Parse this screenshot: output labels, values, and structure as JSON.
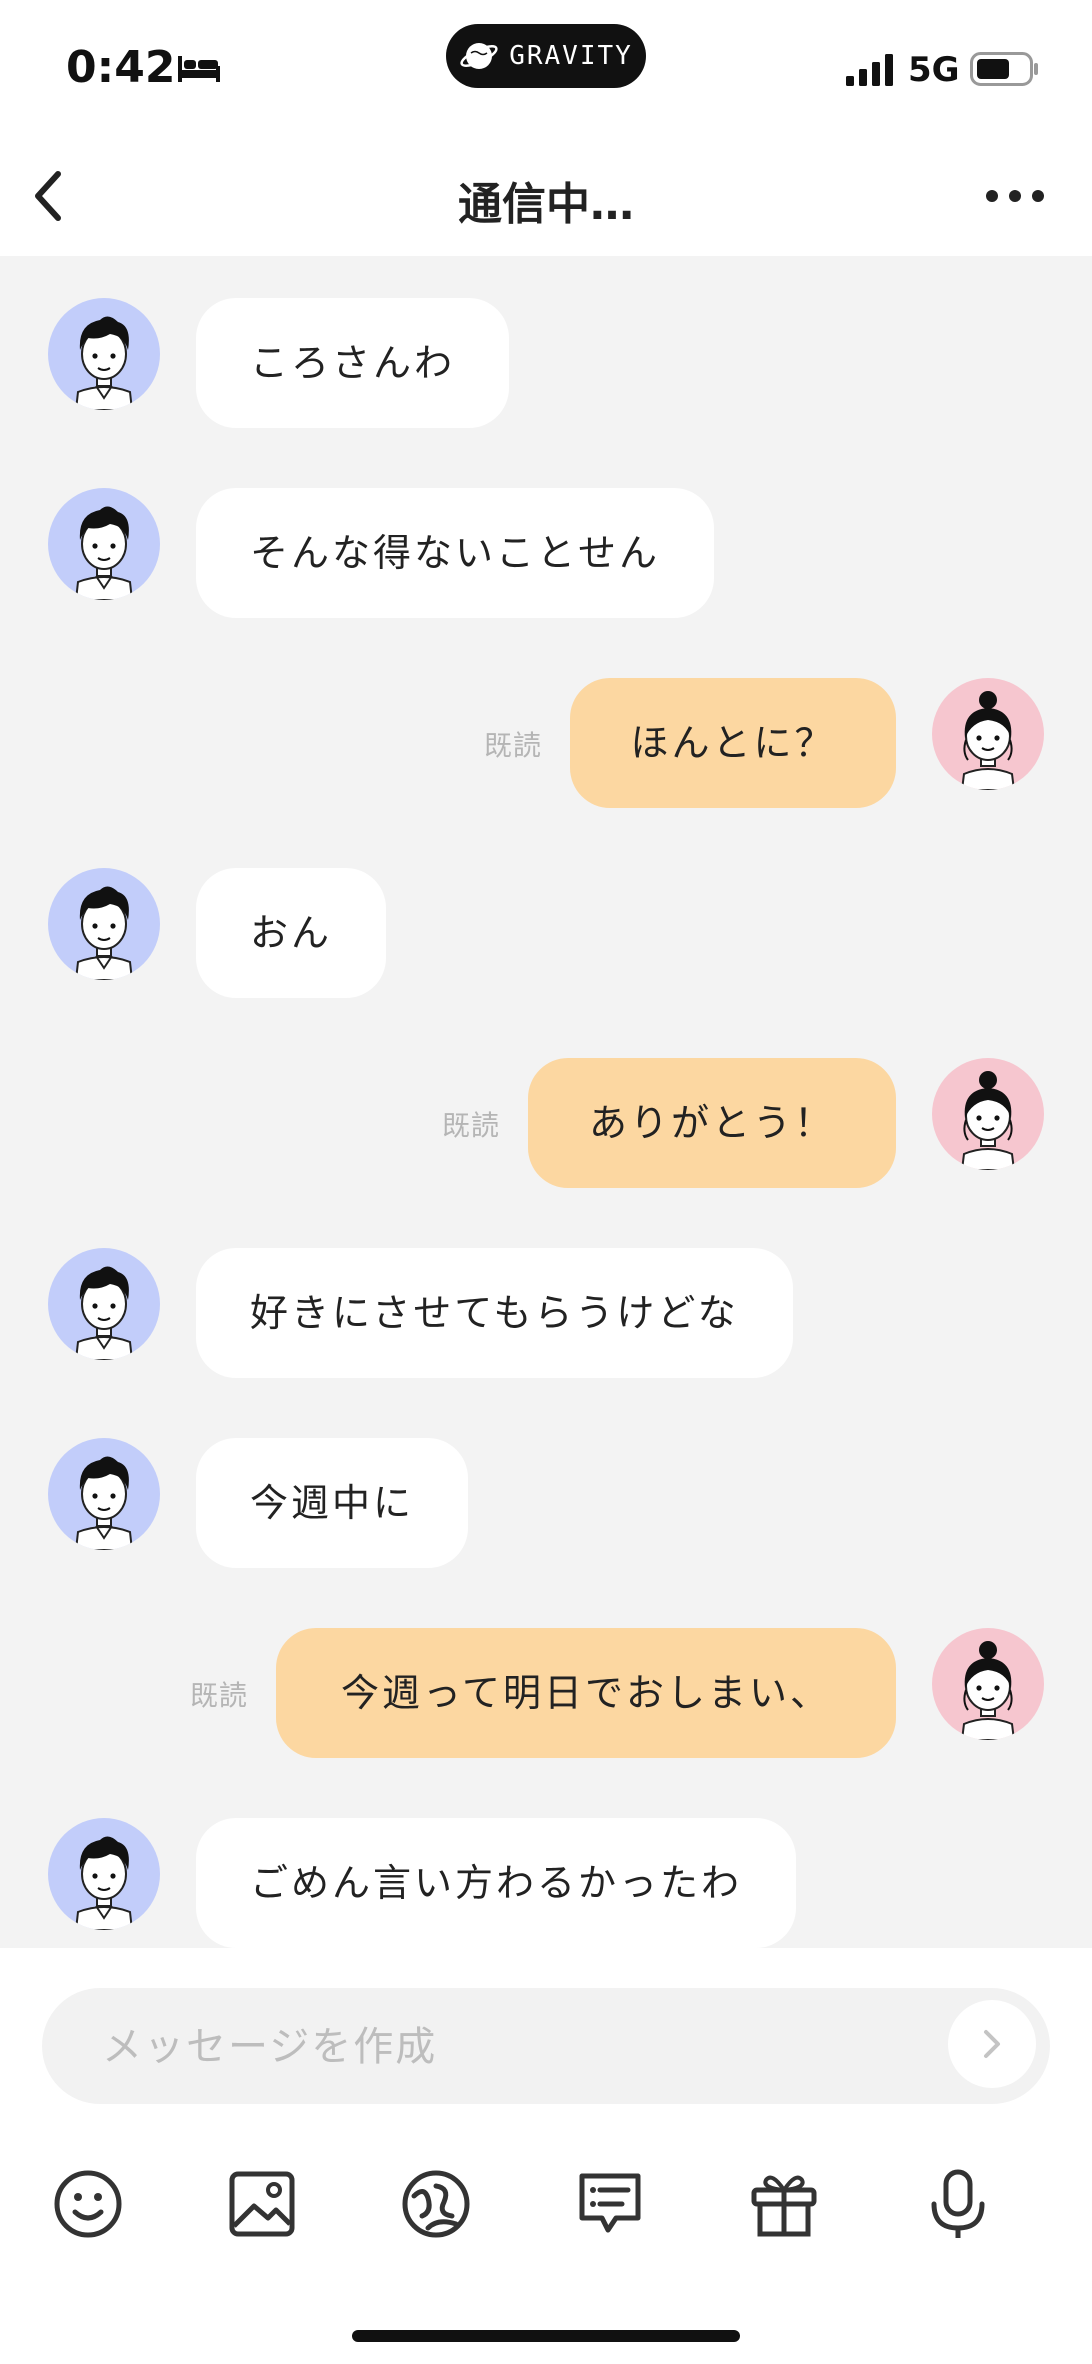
{
  "status_bar": {
    "time": "0:42",
    "pill_text": "GRAVITY",
    "network": "5G"
  },
  "header": {
    "title": "通信中…"
  },
  "messages": [
    {
      "side": "left",
      "text": "ころさんわ"
    },
    {
      "side": "left",
      "text": "そんな得ないことせん"
    },
    {
      "side": "right",
      "text": "ほんとに？",
      "read": "既読"
    },
    {
      "side": "left",
      "text": "おん"
    },
    {
      "side": "right",
      "text": "ありがとう！",
      "read": "既読"
    },
    {
      "side": "left",
      "text": "好きにさせてもらうけどな"
    },
    {
      "side": "left",
      "text": "今週中に"
    },
    {
      "side": "right",
      "text": "今週って明日でおしまい、",
      "read": "既読"
    },
    {
      "side": "left",
      "text": "ごめん言い方わるかったわ"
    }
  ],
  "composer": {
    "placeholder": "メッセージを作成"
  },
  "toolbar": {
    "icons": [
      "emoji-icon",
      "image-icon",
      "sticker-icon",
      "template-message-icon",
      "gift-icon",
      "microphone-icon"
    ]
  },
  "colors": {
    "chat_background": "#f3f3f3",
    "outgoing_bubble": "#fcd7a1",
    "incoming_bubble": "#ffffff",
    "boy_avatar_bg": "#c2cdfa",
    "girl_avatar_bg": "#f6c6cf"
  }
}
